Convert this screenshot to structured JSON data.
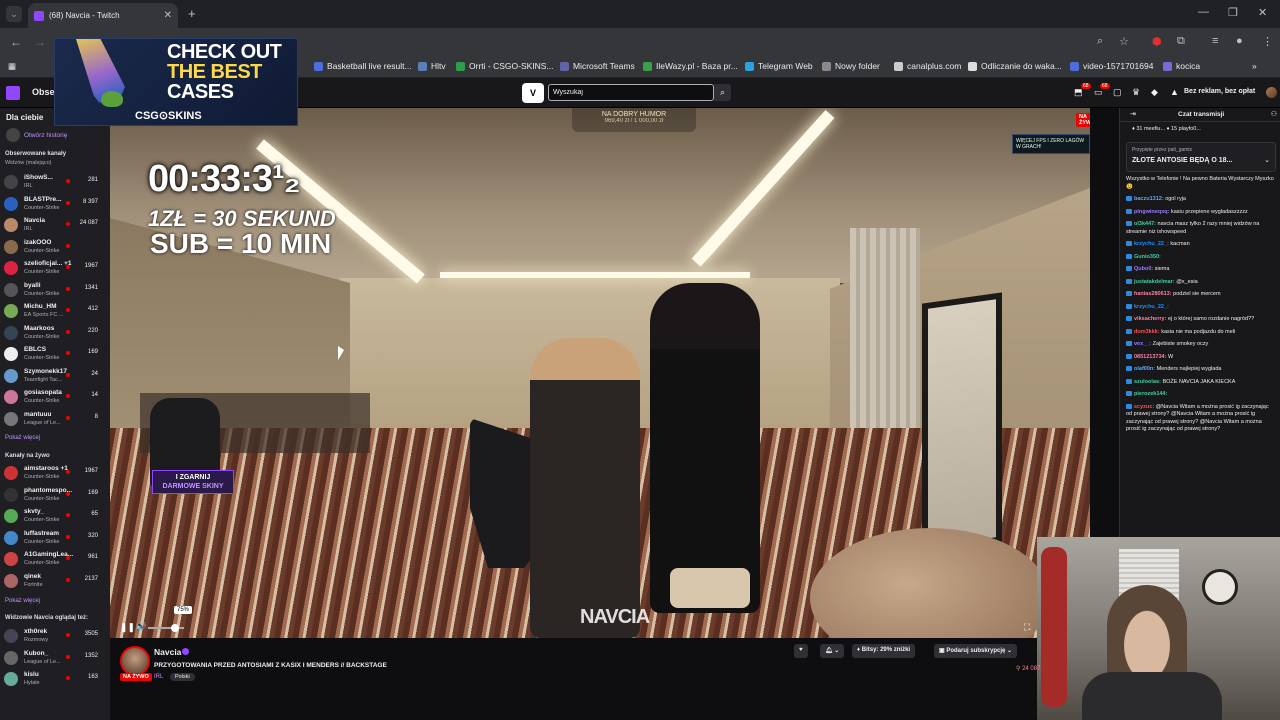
{
  "browser": {
    "tab_title": "(68) Navcia - Twitch",
    "new_tab": "+",
    "tab_menu": "⌄",
    "window_controls": [
      "—",
      "❐",
      "✕"
    ],
    "bookmarks": [
      {
        "label": "Basketball live result...",
        "color": "#4a6ee0"
      },
      {
        "label": "Hltv",
        "color": "#5a7fb8"
      },
      {
        "label": "Orrti - CSGO-SKINS...",
        "color": "#2e9e4a"
      },
      {
        "label": "Microsoft Teams",
        "color": "#6264a7"
      },
      {
        "label": "IleWazy.pl - Baza pr...",
        "color": "#3aa04a"
      },
      {
        "label": "Telegram Web",
        "color": "#2aa3e0"
      },
      {
        "label": "Nowy folder",
        "color": "#8a8a8a"
      },
      {
        "label": "canalplus.com",
        "color": "#cccccc"
      },
      {
        "label": "Odliczanie do waka...",
        "color": "#dddddd"
      },
      {
        "label": "video-1571701694",
        "color": "#4a6ee0"
      },
      {
        "label": "kocica",
        "color": "#7a6ad8"
      }
    ]
  },
  "ad": {
    "line1": "CHECK OUT",
    "line2": "THE BEST",
    "line3": "CASES",
    "brand": "CSG⊙SKINS"
  },
  "twitch": {
    "browse": "Obser",
    "search_placeholder": "Wyszukaj",
    "vbtn": "V",
    "badge_a": "68",
    "badge_b": "68",
    "promo": "Bez reklam, bez opłat"
  },
  "sidebar": {
    "header": "Dla ciebie",
    "history": "Otwórz historię",
    "followed_title": "Obserwowane kanały",
    "followed_sub": "Widzów (malejąco)",
    "followed": [
      {
        "name": "iShowS...",
        "game": "IRL",
        "viewers": "281",
        "color": "#444"
      },
      {
        "name": "BLASTPre...",
        "game": "Counter-Strike",
        "viewers": "8 397",
        "color": "#2b5fbf"
      },
      {
        "name": "Navcia",
        "game": "IRL",
        "viewers": "24 087",
        "color": "#b9896a"
      },
      {
        "name": "izakOOO",
        "game": "Counter-Strike",
        "viewers": "",
        "color": "#8a6a4a"
      },
      {
        "name": "szelioficjal... +1",
        "game": "Counter-Strike",
        "viewers": "1967",
        "color": "#d24"
      },
      {
        "name": "byalli",
        "game": "Counter-Strike",
        "viewers": "1341",
        "color": "#555"
      },
      {
        "name": "Michu_HM",
        "game": "EA Sports FC ...",
        "viewers": "412",
        "color": "#7a5"
      },
      {
        "name": "Maarkoos",
        "game": "Counter-Strike",
        "viewers": "220",
        "color": "#345"
      },
      {
        "name": "EBLCS",
        "game": "Counter-Strike",
        "viewers": "169",
        "color": "#eee"
      },
      {
        "name": "Szymonekk17",
        "game": "Teamfight Tac...",
        "viewers": "24",
        "color": "#69c"
      },
      {
        "name": "gosiasopata",
        "game": "Counter-Strike",
        "viewers": "14",
        "color": "#c79"
      },
      {
        "name": "mantuuu",
        "game": "League of Le...",
        "viewers": "8",
        "color": "#777"
      }
    ],
    "show_more_1": "Pokaż więcej",
    "live_title": "Kanały na żywo",
    "live": [
      {
        "name": "aimstaroos +1",
        "game": "Counter-Strike",
        "viewers": "1967",
        "color": "#c33"
      },
      {
        "name": "phantomespo...",
        "game": "Counter-Strike",
        "viewers": "169",
        "color": "#333"
      },
      {
        "name": "skvty_",
        "game": "Counter-Strike",
        "viewers": "65",
        "color": "#5a5"
      },
      {
        "name": "luffastream",
        "game": "Counter-Strike",
        "viewers": "320",
        "color": "#48c"
      },
      {
        "name": "A1GamingLea...",
        "game": "Counter-Strike",
        "viewers": "961",
        "color": "#c44"
      },
      {
        "name": "qinek",
        "game": "Fortnite",
        "viewers": "2137",
        "color": "#a66"
      }
    ],
    "show_more_2": "Pokaż więcej",
    "also_title": "Widzowie Navcia oglądaj też:",
    "also": [
      {
        "name": "xth0rek",
        "game": "Rozmowy",
        "viewers": "3505",
        "color": "#445"
      },
      {
        "name": "Kubon_",
        "game": "League of Le...",
        "viewers": "1352",
        "color": "#666"
      },
      {
        "name": "kislu",
        "game": "Hytale",
        "viewers": "163",
        "color": "#6a9"
      }
    ]
  },
  "video": {
    "timer": "00:33:3¹₂",
    "rule1": "1ZŁ = 30 SEKUND",
    "rule2": "SUB = 10 MIN",
    "goal_title": "NA DOBRY HUMOR",
    "goal_sub": "969,40 zł / 1 000,00 zł",
    "live_label": "NA ŻYWO",
    "fps_badge": "WIĘCEJ FPS I ZERO LAGÓW W GRACH!",
    "overlay_1": "I ZGARNIJ",
    "overlay_2": "DARMOWE SKINY",
    "watermark": "NAVCIA",
    "volume_pct": "75%",
    "volume_level": 0.75,
    "play_icon": "❚❚",
    "vol_icon": "🔊",
    "full_icon": "⛶"
  },
  "chat": {
    "title": "Czat transmisji",
    "stats": "♦ 31  meefiu...  ♦ 15  playfo0...",
    "pinned_by": "Przypięte przez pati_gamis",
    "pinned_text": "ZŁOTE ANTOSIE BĘDĄ O 18...",
    "messages": [
      {
        "user": "",
        "color": "#efeff1",
        "text": "Wszystko w Telefonie ! Na pewno Bateria Wystarczy Myszko 😉"
      },
      {
        "user": "baczu1312:",
        "color": "#5da9f6",
        "text": "ogol ryja"
      },
      {
        "user": "pingwineqxq:",
        "color": "#9b7bff",
        "text": "kasiu przepiene wygladaszzzzz"
      },
      {
        "user": "ol3k447:",
        "color": "#3fd0a0",
        "text": "navcia masz tylko 2 razy mniej widzów na streamie niz ishowspeed"
      },
      {
        "user": "krzychu_22_:",
        "color": "#1e90ff",
        "text": "kacman"
      },
      {
        "user": "Gunio350:",
        "color": "#3fd0a0",
        "text": ""
      },
      {
        "user": "Qubo0:",
        "color": "#9b7bff",
        "text": "siema"
      },
      {
        "user": "justatakdelmar:",
        "color": "#3fd0a0",
        "text": "@x_esia"
      },
      {
        "user": "hanias280613:",
        "color": "#ff7fa0",
        "text": "podziel sie mercem"
      },
      {
        "user": "krzychu_22_:",
        "color": "#1e90ff",
        "text": ""
      },
      {
        "user": "viksacherry:",
        "color": "#ff7fa0",
        "text": "ej o której samo rozdanie nagród??"
      },
      {
        "user": "dom3kkk:",
        "color": "#ff4f4f",
        "text": "kasia nie ma podjazdu do meli"
      },
      {
        "user": "vex__:",
        "color": "#9b7bff",
        "text": "Zajebiste smokey oczy"
      },
      {
        "user": "0851213734:",
        "color": "#ff7fa0",
        "text": "W"
      },
      {
        "user": "olaf00n:",
        "color": "#5da9f6",
        "text": "Menders najlepiej wyglada"
      },
      {
        "user": "szuloolas:",
        "color": "#3fd0a0",
        "text": "BOŻE NAVCIA JAKA KIECKA"
      },
      {
        "user": "pierozek144:",
        "color": "#3fd0a0",
        "text": ""
      },
      {
        "user": "scyzuc:",
        "color": "#ff4f4f",
        "text": "@Navcia Witam a można prosić ig zaczynając od prawej strony? @Navcia Witam a można prosić ig zaczynając od prawej strony? @Navcia Witam a można prosić ig zaczynając od prawej strony?"
      }
    ]
  },
  "info": {
    "live": "NA ŻYWO",
    "name": "Navcia",
    "title": "PRZYGOTOWANIA PRZED ANTOSIAMI Z KASIX I MENDERS // BACKSTAGE",
    "category": "IRL",
    "tag": "Polski",
    "bits": "Bitsy: 29% zniżki",
    "subscribe": "Podaruj subskrypcję",
    "viewers": "24 087"
  }
}
